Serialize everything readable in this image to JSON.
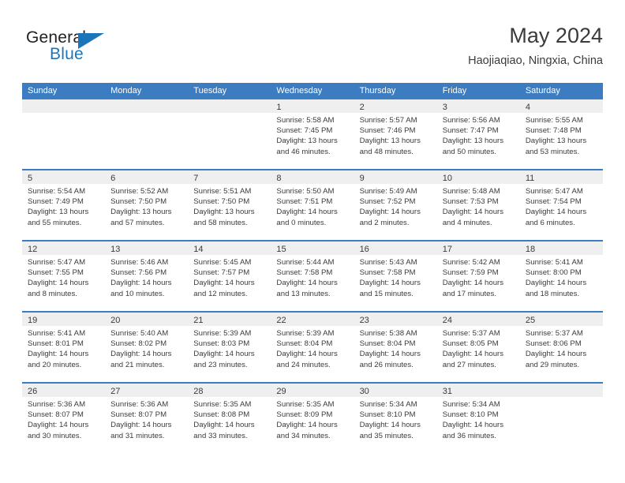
{
  "brand": {
    "name_top": "General",
    "name_bottom": "Blue",
    "accent_color": "#1b75bb"
  },
  "header": {
    "title": "May 2024",
    "subtitle": "Haojiaqiao, Ningxia, China"
  },
  "calendar": {
    "header_color": "#3b7dc0",
    "weekdays": [
      "Sunday",
      "Monday",
      "Tuesday",
      "Wednesday",
      "Thursday",
      "Friday",
      "Saturday"
    ],
    "weeks": [
      [
        {
          "day": "",
          "sunrise": "",
          "sunset": "",
          "daylight": "",
          "daylight2": ""
        },
        {
          "day": "",
          "sunrise": "",
          "sunset": "",
          "daylight": "",
          "daylight2": ""
        },
        {
          "day": "",
          "sunrise": "",
          "sunset": "",
          "daylight": "",
          "daylight2": ""
        },
        {
          "day": "1",
          "sunrise": "Sunrise: 5:58 AM",
          "sunset": "Sunset: 7:45 PM",
          "daylight": "Daylight: 13 hours",
          "daylight2": "and 46 minutes."
        },
        {
          "day": "2",
          "sunrise": "Sunrise: 5:57 AM",
          "sunset": "Sunset: 7:46 PM",
          "daylight": "Daylight: 13 hours",
          "daylight2": "and 48 minutes."
        },
        {
          "day": "3",
          "sunrise": "Sunrise: 5:56 AM",
          "sunset": "Sunset: 7:47 PM",
          "daylight": "Daylight: 13 hours",
          "daylight2": "and 50 minutes."
        },
        {
          "day": "4",
          "sunrise": "Sunrise: 5:55 AM",
          "sunset": "Sunset: 7:48 PM",
          "daylight": "Daylight: 13 hours",
          "daylight2": "and 53 minutes."
        }
      ],
      [
        {
          "day": "5",
          "sunrise": "Sunrise: 5:54 AM",
          "sunset": "Sunset: 7:49 PM",
          "daylight": "Daylight: 13 hours",
          "daylight2": "and 55 minutes."
        },
        {
          "day": "6",
          "sunrise": "Sunrise: 5:52 AM",
          "sunset": "Sunset: 7:50 PM",
          "daylight": "Daylight: 13 hours",
          "daylight2": "and 57 minutes."
        },
        {
          "day": "7",
          "sunrise": "Sunrise: 5:51 AM",
          "sunset": "Sunset: 7:50 PM",
          "daylight": "Daylight: 13 hours",
          "daylight2": "and 58 minutes."
        },
        {
          "day": "8",
          "sunrise": "Sunrise: 5:50 AM",
          "sunset": "Sunset: 7:51 PM",
          "daylight": "Daylight: 14 hours",
          "daylight2": "and 0 minutes."
        },
        {
          "day": "9",
          "sunrise": "Sunrise: 5:49 AM",
          "sunset": "Sunset: 7:52 PM",
          "daylight": "Daylight: 14 hours",
          "daylight2": "and 2 minutes."
        },
        {
          "day": "10",
          "sunrise": "Sunrise: 5:48 AM",
          "sunset": "Sunset: 7:53 PM",
          "daylight": "Daylight: 14 hours",
          "daylight2": "and 4 minutes."
        },
        {
          "day": "11",
          "sunrise": "Sunrise: 5:47 AM",
          "sunset": "Sunset: 7:54 PM",
          "daylight": "Daylight: 14 hours",
          "daylight2": "and 6 minutes."
        }
      ],
      [
        {
          "day": "12",
          "sunrise": "Sunrise: 5:47 AM",
          "sunset": "Sunset: 7:55 PM",
          "daylight": "Daylight: 14 hours",
          "daylight2": "and 8 minutes."
        },
        {
          "day": "13",
          "sunrise": "Sunrise: 5:46 AM",
          "sunset": "Sunset: 7:56 PM",
          "daylight": "Daylight: 14 hours",
          "daylight2": "and 10 minutes."
        },
        {
          "day": "14",
          "sunrise": "Sunrise: 5:45 AM",
          "sunset": "Sunset: 7:57 PM",
          "daylight": "Daylight: 14 hours",
          "daylight2": "and 12 minutes."
        },
        {
          "day": "15",
          "sunrise": "Sunrise: 5:44 AM",
          "sunset": "Sunset: 7:58 PM",
          "daylight": "Daylight: 14 hours",
          "daylight2": "and 13 minutes."
        },
        {
          "day": "16",
          "sunrise": "Sunrise: 5:43 AM",
          "sunset": "Sunset: 7:58 PM",
          "daylight": "Daylight: 14 hours",
          "daylight2": "and 15 minutes."
        },
        {
          "day": "17",
          "sunrise": "Sunrise: 5:42 AM",
          "sunset": "Sunset: 7:59 PM",
          "daylight": "Daylight: 14 hours",
          "daylight2": "and 17 minutes."
        },
        {
          "day": "18",
          "sunrise": "Sunrise: 5:41 AM",
          "sunset": "Sunset: 8:00 PM",
          "daylight": "Daylight: 14 hours",
          "daylight2": "and 18 minutes."
        }
      ],
      [
        {
          "day": "19",
          "sunrise": "Sunrise: 5:41 AM",
          "sunset": "Sunset: 8:01 PM",
          "daylight": "Daylight: 14 hours",
          "daylight2": "and 20 minutes."
        },
        {
          "day": "20",
          "sunrise": "Sunrise: 5:40 AM",
          "sunset": "Sunset: 8:02 PM",
          "daylight": "Daylight: 14 hours",
          "daylight2": "and 21 minutes."
        },
        {
          "day": "21",
          "sunrise": "Sunrise: 5:39 AM",
          "sunset": "Sunset: 8:03 PM",
          "daylight": "Daylight: 14 hours",
          "daylight2": "and 23 minutes."
        },
        {
          "day": "22",
          "sunrise": "Sunrise: 5:39 AM",
          "sunset": "Sunset: 8:04 PM",
          "daylight": "Daylight: 14 hours",
          "daylight2": "and 24 minutes."
        },
        {
          "day": "23",
          "sunrise": "Sunrise: 5:38 AM",
          "sunset": "Sunset: 8:04 PM",
          "daylight": "Daylight: 14 hours",
          "daylight2": "and 26 minutes."
        },
        {
          "day": "24",
          "sunrise": "Sunrise: 5:37 AM",
          "sunset": "Sunset: 8:05 PM",
          "daylight": "Daylight: 14 hours",
          "daylight2": "and 27 minutes."
        },
        {
          "day": "25",
          "sunrise": "Sunrise: 5:37 AM",
          "sunset": "Sunset: 8:06 PM",
          "daylight": "Daylight: 14 hours",
          "daylight2": "and 29 minutes."
        }
      ],
      [
        {
          "day": "26",
          "sunrise": "Sunrise: 5:36 AM",
          "sunset": "Sunset: 8:07 PM",
          "daylight": "Daylight: 14 hours",
          "daylight2": "and 30 minutes."
        },
        {
          "day": "27",
          "sunrise": "Sunrise: 5:36 AM",
          "sunset": "Sunset: 8:07 PM",
          "daylight": "Daylight: 14 hours",
          "daylight2": "and 31 minutes."
        },
        {
          "day": "28",
          "sunrise": "Sunrise: 5:35 AM",
          "sunset": "Sunset: 8:08 PM",
          "daylight": "Daylight: 14 hours",
          "daylight2": "and 33 minutes."
        },
        {
          "day": "29",
          "sunrise": "Sunrise: 5:35 AM",
          "sunset": "Sunset: 8:09 PM",
          "daylight": "Daylight: 14 hours",
          "daylight2": "and 34 minutes."
        },
        {
          "day": "30",
          "sunrise": "Sunrise: 5:34 AM",
          "sunset": "Sunset: 8:10 PM",
          "daylight": "Daylight: 14 hours",
          "daylight2": "and 35 minutes."
        },
        {
          "day": "31",
          "sunrise": "Sunrise: 5:34 AM",
          "sunset": "Sunset: 8:10 PM",
          "daylight": "Daylight: 14 hours",
          "daylight2": "and 36 minutes."
        },
        {
          "day": "",
          "sunrise": "",
          "sunset": "",
          "daylight": "",
          "daylight2": ""
        }
      ]
    ]
  }
}
